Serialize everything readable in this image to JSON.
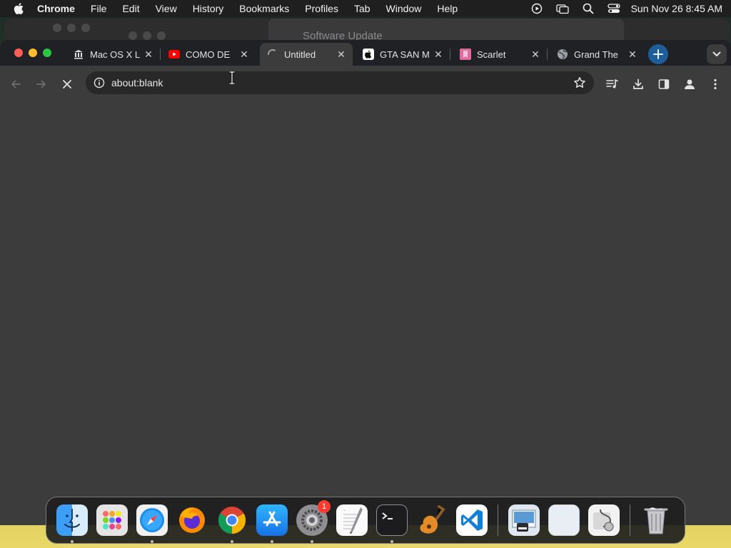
{
  "menubar": {
    "app_name": "Chrome",
    "items": [
      "File",
      "Edit",
      "View",
      "History",
      "Bookmarks",
      "Profiles",
      "Tab",
      "Window",
      "Help"
    ],
    "clock": "Sun Nov 26  8:45 AM"
  },
  "background_window": {
    "title": "Software Update"
  },
  "tabs": [
    {
      "title": "Mac OS X L",
      "icon": "bank-icon"
    },
    {
      "title": "COMO DE",
      "icon": "youtube-icon"
    },
    {
      "title": "Untitled",
      "icon": "loading-spinner-icon",
      "active": true
    },
    {
      "title": "GTA SAN M",
      "icon": "apple-icon"
    },
    {
      "title": "Scarlet",
      "icon": "pink-bookmark-icon"
    },
    {
      "title": "Grand The",
      "icon": "globe-icon"
    }
  ],
  "address_bar": {
    "url": "about:blank"
  },
  "dock": {
    "apps": [
      {
        "name": "Finder",
        "icon": "finder-icon",
        "running": true
      },
      {
        "name": "Launchpad",
        "icon": "launchpad-icon",
        "running": false
      },
      {
        "name": "Safari",
        "icon": "safari-icon",
        "running": true
      },
      {
        "name": "Firefox",
        "icon": "firefox-icon",
        "running": false
      },
      {
        "name": "Chrome",
        "icon": "chrome-icon",
        "running": true
      },
      {
        "name": "App Store",
        "icon": "app-store-icon",
        "running": true
      },
      {
        "name": "System Settings",
        "icon": "system-settings-icon",
        "running": true,
        "badge": "1"
      },
      {
        "name": "TextEdit",
        "icon": "textedit-icon",
        "running": false
      },
      {
        "name": "Terminal",
        "icon": "terminal-icon",
        "running": true
      },
      {
        "name": "GarageBand",
        "icon": "garageband-icon",
        "running": false
      },
      {
        "name": "Visual Studio Code",
        "icon": "vscode-icon",
        "running": false
      }
    ],
    "others": [
      {
        "name": "Preview",
        "icon": "preview-icon"
      },
      {
        "name": "Blank",
        "icon": "blank-app-icon"
      },
      {
        "name": "Disk Utility",
        "icon": "disk-utility-icon"
      }
    ],
    "trash": {
      "name": "Trash",
      "icon": "trash-icon"
    }
  },
  "colors": {
    "tab_strip": "#202124",
    "toolbar": "#3c3c3c",
    "new_tab_button": "#1d5d99",
    "close": "#ff5f57",
    "minimize": "#febc2e",
    "maximize": "#28c840"
  }
}
